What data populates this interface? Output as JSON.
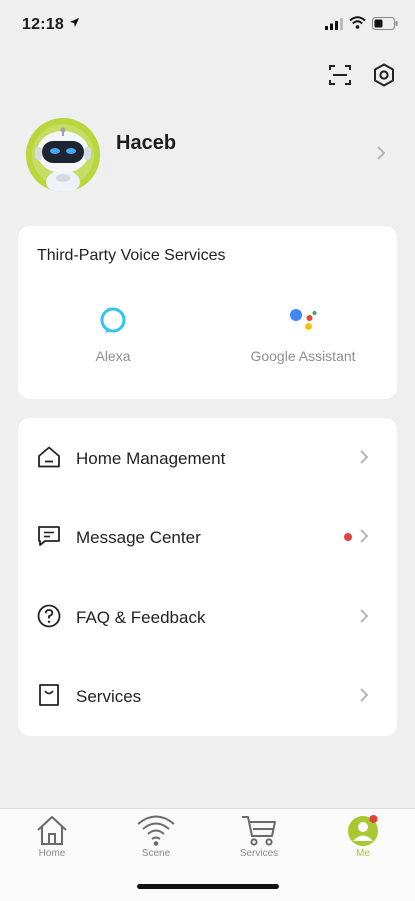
{
  "status_bar": {
    "time": "12:18"
  },
  "profile": {
    "name": "Haceb"
  },
  "voice_services": {
    "title": "Third-Party Voice Services",
    "items": [
      {
        "label": "Alexa",
        "icon": "alexa-icon"
      },
      {
        "label": "Google Assistant",
        "icon": "google-assistant-icon"
      }
    ]
  },
  "menu": {
    "items": [
      {
        "label": "Home Management",
        "icon": "home-icon"
      },
      {
        "label": "Message Center",
        "icon": "message-icon",
        "has_notification": true
      },
      {
        "label": "FAQ & Feedback",
        "icon": "question-icon"
      },
      {
        "label": "Services",
        "icon": "services-icon"
      }
    ]
  },
  "tabbar": {
    "tabs": [
      {
        "label": "Home",
        "icon": "home-tab-icon"
      },
      {
        "label": "Scene",
        "icon": "scene-tab-icon"
      },
      {
        "label": "Services",
        "icon": "cart-icon"
      },
      {
        "label": "Me",
        "icon": "me-tab-icon",
        "active": true
      }
    ]
  },
  "colors": {
    "accent": "#a8c832",
    "notification": "#e0423c",
    "alexa": "#31c4f3"
  }
}
